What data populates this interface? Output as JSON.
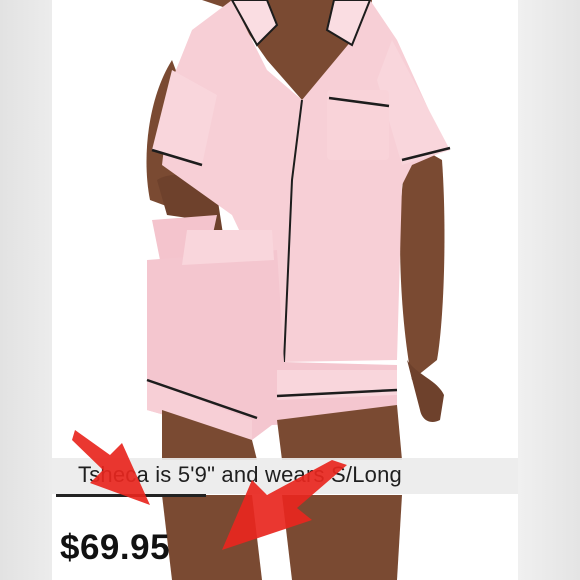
{
  "listing": {
    "caption": "Tsheca  is 5'9\" and wears S/Long",
    "price": "$69.95"
  },
  "photo": {
    "subject": "pink-short-sleeve-pajama-set",
    "top_color": "#f7cfd6",
    "piping_color": "#1d1d1d",
    "skin_color": "#7a4a32"
  },
  "annotations": {
    "arrow_color": "#e8261e",
    "arrow_count": 2
  }
}
